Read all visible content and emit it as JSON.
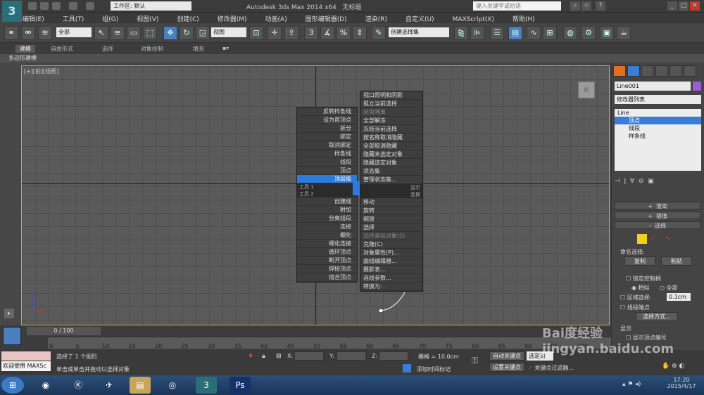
{
  "app": {
    "title": "Autodesk 3ds Max  2014 x64",
    "document": "无标题",
    "workspace": "工作区: 默认",
    "search_placeholder": "键入关键字或短语"
  },
  "menu": [
    "编辑(E)",
    "工具(T)",
    "组(G)",
    "视图(V)",
    "创建(C)",
    "修改器(M)",
    "动画(A)",
    "图形编辑器(D)",
    "渲染(R)",
    "自定义(U)",
    "MAXScript(X)",
    "帮助(H)"
  ],
  "toolbar": {
    "filter": "全部",
    "refcoord": "视图",
    "named_sel": "创建选择集",
    "snap_label": "3",
    "pct_label": "%"
  },
  "ribbon": {
    "tabs": [
      "建模",
      "自由形式",
      "选择",
      "对象绘制",
      "填充"
    ],
    "sub": "多边形建模"
  },
  "viewport": {
    "label": "[+][前][线框]",
    "cube_label": "前"
  },
  "quad_left": {
    "items": [
      "反转样条线",
      "设为首顶点",
      "拆分",
      "绑定",
      "取消绑定",
      "样条线",
      "线段",
      "顶点",
      "顶层级"
    ],
    "bar1": "工具 1",
    "bar2": "工具 2",
    "lower": [
      "创建线",
      "附加",
      "分离线段",
      "连接",
      "细化",
      "细化连接",
      "循环顶点",
      "断开顶点",
      "焊接顶点",
      "熔合顶点"
    ]
  },
  "quad_right": {
    "upper": [
      "视口照明和阴影",
      "孤立当前选择",
      "结束隔离",
      "全部解冻",
      "冻结当前选择",
      "按名称取消隐藏",
      "全部取消隐藏",
      "隐藏未选定对象",
      "隐藏选定对象",
      "状态集",
      "管理状态集..."
    ],
    "bar1": "显示",
    "bar2": "变换",
    "lower": [
      "移动",
      "旋转",
      "缩放",
      "选择",
      "选择类似对象(S)",
      "克隆(C)",
      "对象属性(P)...",
      "曲线编辑器...",
      "摄影表...",
      "连线参数...",
      "转换为:"
    ]
  },
  "command_panel": {
    "object_name": "Line001",
    "modifier_list": "修改器列表",
    "stack": [
      "Line",
      "顶点",
      "线段",
      "样条线"
    ],
    "rollouts": [
      "渲染",
      "插值",
      "选择"
    ],
    "named_sel": "命名选择:",
    "copy": "复制",
    "paste": "粘贴",
    "lock_handles": "锁定控制柄",
    "similar": "相似",
    "all": "全部",
    "area_sel": "区域选择:",
    "area_val": "0.1cm",
    "seg_end": "线段端点",
    "sel_method": "选择方式...",
    "display": "显示",
    "show_vnum": "显示顶点编号"
  },
  "timeline": {
    "frame": "0 / 100",
    "ticks": [
      "0",
      "5",
      "10",
      "15",
      "20",
      "25",
      "30",
      "35",
      "40",
      "45",
      "50",
      "55",
      "60",
      "65",
      "70",
      "75",
      "80",
      "85",
      "90",
      "95",
      "100"
    ]
  },
  "status": {
    "welcome": "欢迎使用 MAXSc",
    "selected": "选择了 1 个图形",
    "prompt": "单击或单击并拖动以选择对象",
    "x": "X:",
    "y": "Y:",
    "z": "Z:",
    "grid": "栅格 = 10.0cm",
    "autokey": "自动关键点",
    "setkey": "设置关键点",
    "add_tag": "添加时间标记",
    "sel": "选定对",
    "keyfilter": "关键点过滤器..."
  },
  "clock": {
    "time": "17:20",
    "date": "2015/4/17"
  },
  "watermark": "Bai度经验  jingyan.baidu.com"
}
